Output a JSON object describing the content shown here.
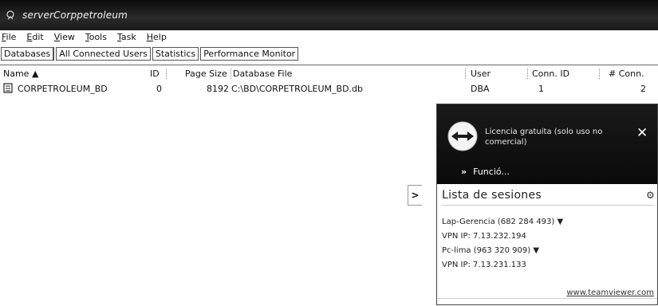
{
  "window": {
    "title": "serverCorppetroleum"
  },
  "menu": [
    "File",
    "Edit",
    "View",
    "Tools",
    "Task",
    "Help"
  ],
  "tabs": [
    "Databases",
    "All Connected Users",
    "Statistics",
    "Performance Monitor"
  ],
  "columns": {
    "name": "Name ▲",
    "id": "ID",
    "page_size": "Page Size",
    "database_file": "Database File",
    "user": "User",
    "conn_id": "Conn. ID",
    "num_conn": "# Conn."
  },
  "rows": [
    {
      "name": "CORPETROLEUM_BD",
      "id": "0",
      "page_size": "8192",
      "database_file": "C:\\BD\\CORPETROLEUM_BD.db",
      "user": "DBA",
      "conn_id": "1",
      "num_conn": "2"
    }
  ],
  "side_arrow": ">",
  "teamviewer": {
    "license_text": "Licencia gratuita (solo uso no comercial)",
    "close": "✕",
    "function_label": "Funció...",
    "function_chevron": "»",
    "list_title": "Lista de sesiones",
    "sessions": [
      "Lap-Gerencia (682 284 493) ▼",
      "VPN IP: 7.13.232.194",
      "Pc-lima (963 320 909) ▼",
      "VPN IP: 7.13.231.133"
    ],
    "footer_link": "www.teamviewer.com",
    "accent_color": "#0e0e0e"
  }
}
